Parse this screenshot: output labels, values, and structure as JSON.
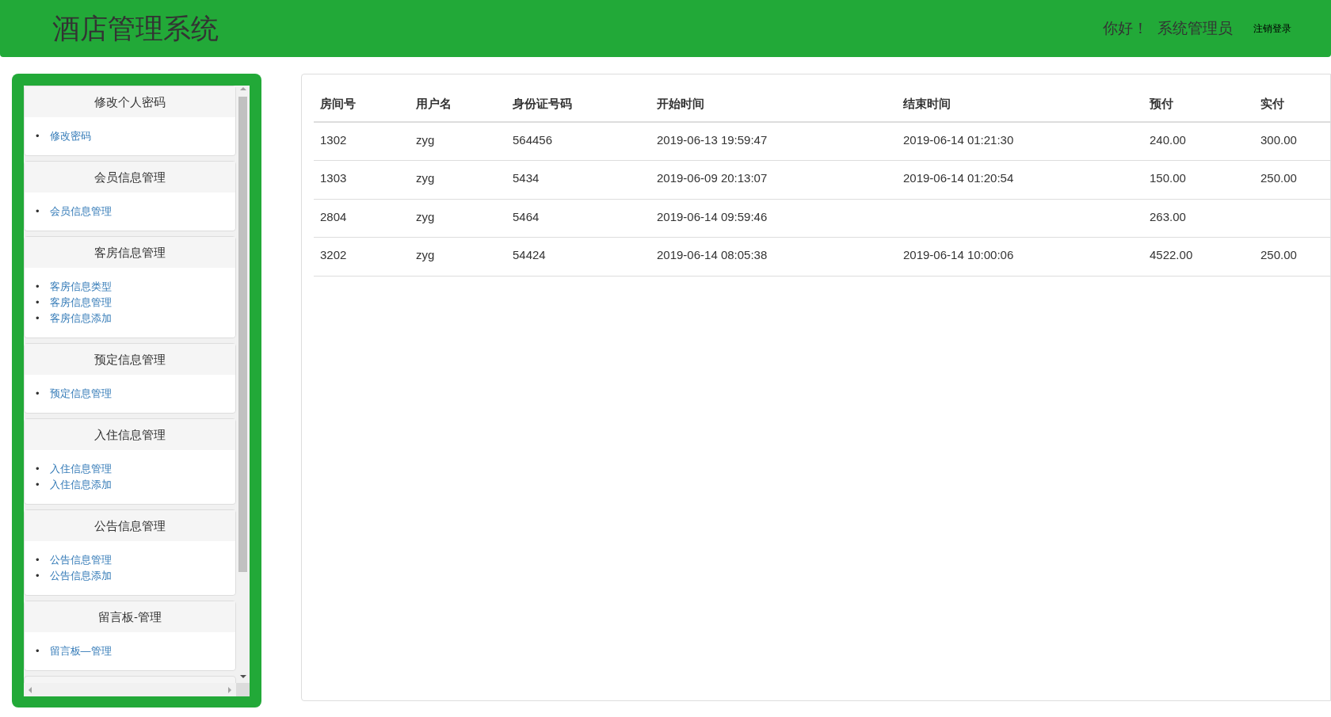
{
  "header": {
    "title": "酒店管理系统",
    "greeting": "你好！",
    "user": "系统管理员",
    "logout": "注销登录"
  },
  "sidebar": {
    "bullet": "•",
    "sections": [
      {
        "title": "修改个人密码",
        "links": [
          "修改密码"
        ]
      },
      {
        "title": "会员信息管理",
        "links": [
          "会员信息管理"
        ]
      },
      {
        "title": "客房信息管理",
        "links": [
          "客房信息类型",
          "客房信息管理",
          "客房信息添加"
        ]
      },
      {
        "title": "预定信息管理",
        "links": [
          "预定信息管理"
        ]
      },
      {
        "title": "入住信息管理",
        "links": [
          "入住信息管理",
          "入住信息添加"
        ]
      },
      {
        "title": "公告信息管理",
        "links": [
          "公告信息管理",
          "公告信息添加"
        ]
      },
      {
        "title": "留言板-管理",
        "links": [
          "留言板—管理"
        ]
      }
    ]
  },
  "table": {
    "columns": [
      "房间号",
      "用户名",
      "身份证号码",
      "开始时间",
      "结束时间",
      "预付",
      "实付"
    ],
    "rows": [
      [
        "1302",
        "zyg",
        "564456",
        "2019-06-13 19:59:47",
        "2019-06-14 01:21:30",
        "240.00",
        "300.00"
      ],
      [
        "1303",
        "zyg",
        "5434",
        "2019-06-09 20:13:07",
        "2019-06-14 01:20:54",
        "150.00",
        "250.00"
      ],
      [
        "2804",
        "zyg",
        "5464",
        "2019-06-14 09:59:46",
        "",
        "263.00",
        ""
      ],
      [
        "3202",
        "zyg",
        "54424",
        "2019-06-14 08:05:38",
        "2019-06-14 10:00:06",
        "4522.00",
        "250.00"
      ]
    ]
  }
}
